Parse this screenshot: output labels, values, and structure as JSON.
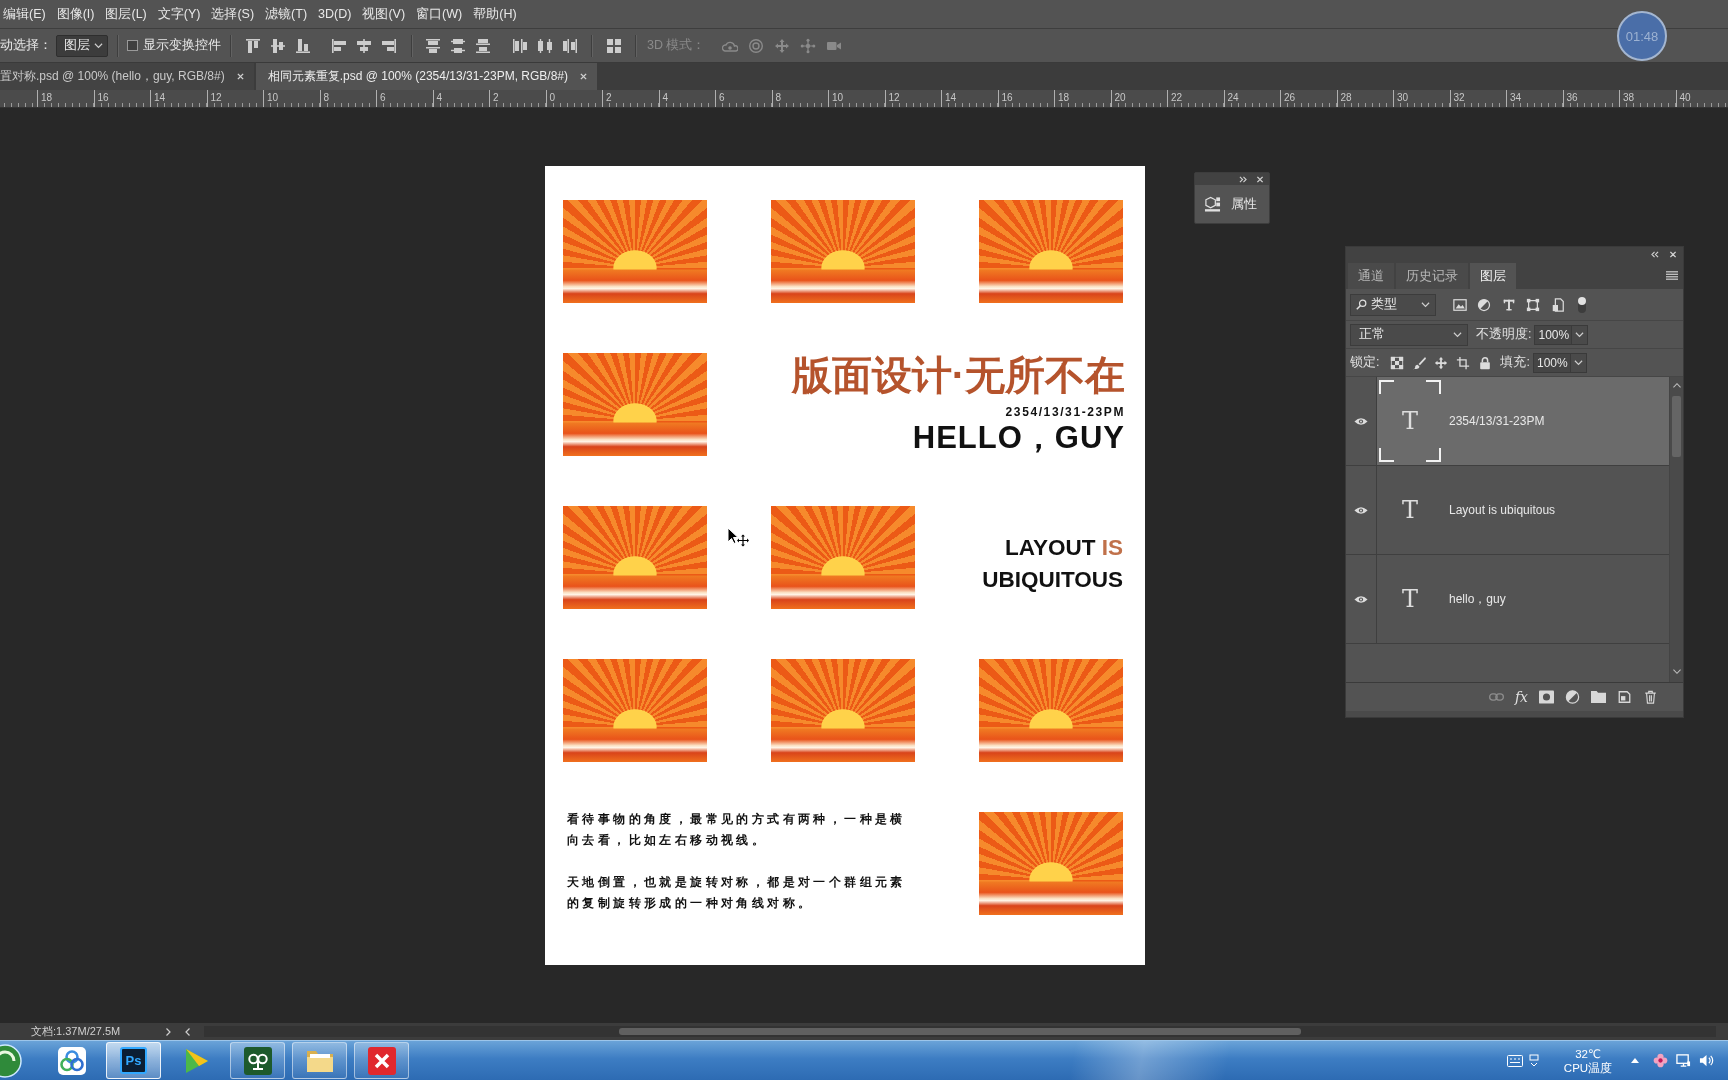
{
  "menu_bar": {
    "items": [
      "编辑(E)",
      "图像(I)",
      "图层(L)",
      "文字(Y)",
      "选择(S)",
      "滤镜(T)",
      "3D(D)",
      "视图(V)",
      "窗口(W)",
      "帮助(H)"
    ]
  },
  "options_bar": {
    "auto_select_label": "动选择：",
    "auto_select_target": "图层",
    "show_transform_controls": {
      "label": "显示变换控件",
      "checked": false
    },
    "mode_3d": {
      "label": "3D 模式：",
      "disabled": true
    }
  },
  "timer_badge": {
    "text": "01:48"
  },
  "document_tabs": [
    {
      "title": "置对称.psd @ 100% (hello，guy, RGB/8#)",
      "selected": false
    },
    {
      "title": "相同元素重复.psd @ 100% (2354/13/31-23PM, RGB/8#)",
      "selected": true
    }
  ],
  "ruler": {
    "labels": [
      "18",
      "16",
      "14",
      "12",
      "10",
      "8",
      "6",
      "4",
      "2",
      "0",
      "2",
      "4",
      "6",
      "8",
      "10",
      "12",
      "14",
      "16",
      "18",
      "20",
      "22",
      "24",
      "26",
      "28",
      "30",
      "32",
      "34",
      "36",
      "38",
      "40"
    ]
  },
  "document": {
    "blocks": [
      {
        "kind": "image"
      },
      {
        "kind": "image"
      },
      {
        "kind": "image"
      },
      {
        "kind": "image"
      },
      {
        "kind": "heading",
        "title": "版面设计·无所不在",
        "date": "2354/13/31-23PM",
        "greeting": "HELLO，GUY"
      },
      {
        "kind": "image"
      },
      {
        "kind": "image"
      },
      {
        "kind": "tagline",
        "lines": [
          [
            {
              "text": "LAYOUT",
              "accent": false
            },
            {
              "text": "IS",
              "accent": true
            }
          ],
          [
            {
              "text": "UBIQUITOUS",
              "accent": false
            }
          ]
        ]
      },
      {
        "kind": "image"
      },
      {
        "kind": "image"
      },
      {
        "kind": "image"
      },
      {
        "kind": "paragraphs",
        "paragraphs": [
          "看待事物的角度，最常见的方式有两种，一种是横向去看，比如左右移动视线。",
          "天地倒置，也就是旋转对称，都是对一个群组元素的复制旋转形成的一种对角线对称。"
        ]
      },
      {
        "kind": "image"
      }
    ]
  },
  "properties_panel": {
    "label": "属性"
  },
  "layers_panel": {
    "tabs": [
      {
        "label": "通道",
        "selected": false
      },
      {
        "label": "历史记录",
        "selected": false
      },
      {
        "label": "图层",
        "selected": true
      }
    ],
    "filter_type": "类型",
    "blend_mode": "正常",
    "opacity_label": "不透明度:",
    "opacity": "100%",
    "lock_label": "锁定:",
    "fill_label": "填充:",
    "fill": "100%",
    "layers": [
      {
        "name": "2354/13/31-23PM",
        "thumbnail": "T",
        "visible": true,
        "selected": true
      },
      {
        "name": "Layout is ubiquitous",
        "thumbnail": "T",
        "visible": true,
        "selected": false
      },
      {
        "name": "hello，guy",
        "thumbnail": "T",
        "visible": true,
        "selected": false
      }
    ],
    "effects_label": "fx"
  },
  "status_bar": {
    "document_size": "文档:1.37M/27.5M"
  },
  "taskbar": {
    "apps": [
      {
        "kind": "rings",
        "running": false,
        "selected": false
      },
      {
        "kind": "logo",
        "logo_text": "Ps",
        "running": true,
        "selected": true
      },
      {
        "kind": "player",
        "running": false,
        "selected": false
      },
      {
        "kind": "tile",
        "running": true,
        "selected": false
      },
      {
        "kind": "folder",
        "running": true,
        "selected": false
      },
      {
        "kind": "cross",
        "running": true,
        "selected": false
      }
    ],
    "temperature": "32℃",
    "temperature_label": "CPU温度"
  }
}
